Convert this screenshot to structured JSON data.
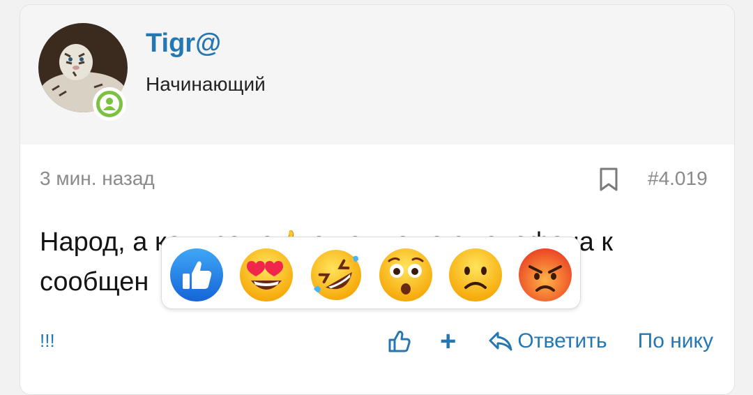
{
  "user": {
    "name": "Tigr@",
    "title": "Начинающий"
  },
  "post": {
    "time": "3 мин. назад",
    "number": "#4.019",
    "text_line1_a": "Народ, а ",
    "text_line1_b": "как кроме",
    "text_line1_c": " еще что то с телефона к",
    "text_line2": "сообщен"
  },
  "reactions": [
    "like-reaction",
    "heart-eyes-reaction",
    "rofl-reaction",
    "flushed-reaction",
    "frown-reaction",
    "angry-reaction"
  ],
  "footer": {
    "left": "!!!",
    "plus": "+",
    "reply": "Ответить",
    "quote": "По нику"
  },
  "colors": {
    "accent": "#2577b1",
    "status": "#7cc142",
    "meta": "#8a8a8a"
  }
}
